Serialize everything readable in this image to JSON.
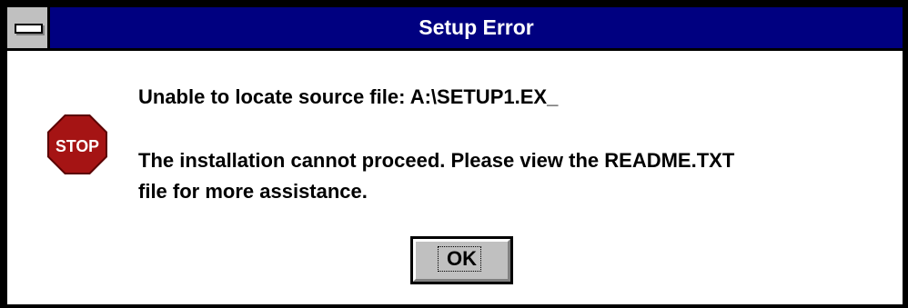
{
  "window": {
    "title": "Setup Error"
  },
  "icon": {
    "name": "stop-icon",
    "text": "STOP",
    "color": "#a51414"
  },
  "message": {
    "line1": "Unable to locate source file: A:\\SETUP1.EX_",
    "line2": "The installation cannot proceed. Please view the README.TXT",
    "line3": "file for more assistance."
  },
  "buttons": {
    "ok_label": "OK"
  },
  "colors": {
    "titlebar": "#000080",
    "titlebar_text": "#ffffff",
    "button_face": "#c0c0c0",
    "background": "#ffffff"
  }
}
